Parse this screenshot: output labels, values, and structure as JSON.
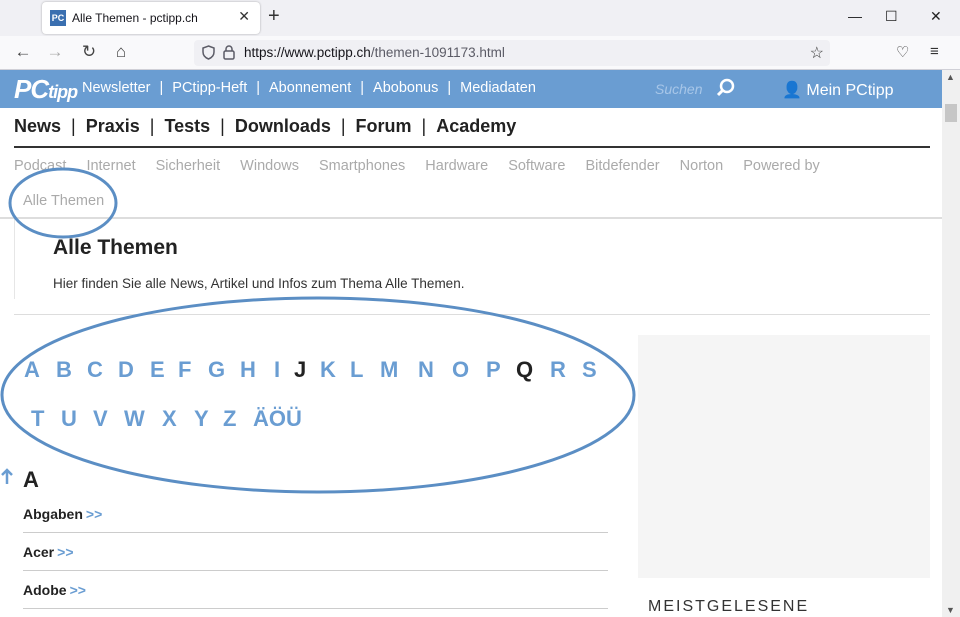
{
  "browser": {
    "tab_title": "Alle Themen - pctipp.ch",
    "tab_favicon": "PC",
    "url_host": "https://www.pctipp.ch",
    "url_path": "/themen-1091173.html"
  },
  "site": {
    "logo_main": "PC",
    "logo_sub": "tipp",
    "top_links": [
      "Newsletter",
      "PCtipp-Heft",
      "Abonnement",
      "Abobonus",
      "Mediadaten"
    ],
    "search_placeholder": "Suchen",
    "account_label": "Mein PCtipp",
    "main_nav": [
      "News",
      "Praxis",
      "Tests",
      "Downloads",
      "Forum",
      "Academy"
    ],
    "sub_nav": [
      "Podcast",
      "Internet",
      "Sicherheit",
      "Windows",
      "Smartphones",
      "Hardware",
      "Software",
      "Bitdefender",
      "Norton",
      "Powered by"
    ],
    "sub_nav_current": "Alle Themen",
    "brand_color": "#6a9dd2"
  },
  "content": {
    "title": "Alle Themen",
    "description": "Hier finden Sie alle News, Artikel und Infos zum Thema Alle Themen.",
    "alphabet_row1": [
      "A",
      "B",
      "C",
      "D",
      "E",
      "F",
      "G",
      "H",
      "I",
      "J",
      "K",
      "L",
      "M",
      "N",
      "O",
      "P",
      "Q",
      "R",
      "S"
    ],
    "alphabet_row2": [
      "T",
      "U",
      "V",
      "W",
      "X",
      "Y",
      "Z",
      "ÄÖÜ"
    ],
    "disabled_letters": [
      "J",
      "Q"
    ],
    "section_letter": "A",
    "topics": [
      "Abgaben",
      "Acer",
      "Adobe"
    ],
    "more_marker": ">>",
    "sidebar_title": "MEISTGELESENE"
  }
}
